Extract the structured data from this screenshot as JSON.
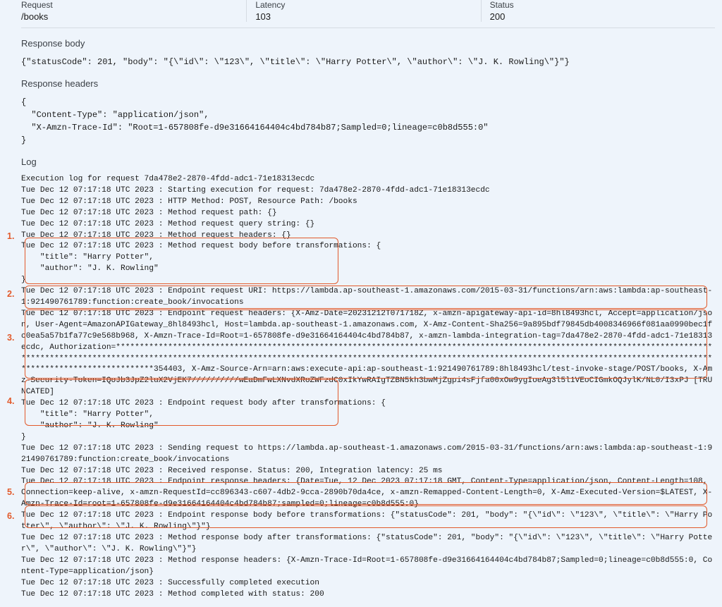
{
  "header": {
    "request_label": "Request",
    "request_value": "/books",
    "latency_label": "Latency",
    "latency_value": "103",
    "status_label": "Status",
    "status_value": "200"
  },
  "sections": {
    "response_body_title": "Response body",
    "response_body": "{\"statusCode\": 201, \"body\": \"{\\\"id\\\": \\\"123\\\", \\\"title\\\": \\\"Harry Potter\\\", \\\"author\\\": \\\"J. K. Rowling\\\"}\"}",
    "response_headers_title": "Response headers",
    "response_headers": "{\n  \"Content-Type\": \"application/json\",\n  \"X-Amzn-Trace-Id\": \"Root=1-657808fe-d9e31664164404c4bd784b87;Sampled=0;lineage=c0b8d555:0\"\n}",
    "log_title": "Log",
    "log_text": "Execution log for request 7da478e2-2870-4fdd-adc1-71e18313ecdc\nTue Dec 12 07:17:18 UTC 2023 : Starting execution for request: 7da478e2-2870-4fdd-adc1-71e18313ecdc\nTue Dec 12 07:17:18 UTC 2023 : HTTP Method: POST, Resource Path: /books\nTue Dec 12 07:17:18 UTC 2023 : Method request path: {}\nTue Dec 12 07:17:18 UTC 2023 : Method request query string: {}\nTue Dec 12 07:17:18 UTC 2023 : Method request headers: {}\nTue Dec 12 07:17:18 UTC 2023 : Method request body before transformations: {\n    \"title\": \"Harry Potter\",\n    \"author\": \"J. K. Rowling\"\n}\nTue Dec 12 07:17:18 UTC 2023 : Endpoint request URI: https://lambda.ap-southeast-1.amazonaws.com/2015-03-31/functions/arn:aws:lambda:ap-southeast-1:921490761789:function:create_book/invocations\nTue Dec 12 07:17:18 UTC 2023 : Endpoint request headers: {X-Amz-Date=20231212T071718Z, x-amzn-apigateway-api-id=8hl8493hcl, Accept=application/json, User-Agent=AmazonAPIGateway_8hl8493hcl, Host=lambda.ap-southeast-1.amazonaws.com, X-Amz-Content-Sha256=9a895bdf79845db4008346966f081aa0990bec1fc0ea5a57b1fa77c9e568b968, X-Amzn-Trace-Id=Root=1-657808fe-d9e31664164404c4bd784b87, x-amzn-lambda-integration-tag=7da478e2-2870-4fdd-adc1-71e18313ecdc, Authorization=************************************************************************************************************************************************************************************************************************************************************************************************************354403, X-Amz-Source-Arn=arn:aws:execute-api:ap-southeast-1:921490761789:8hl8493hcl/test-invoke-stage/POST/books, X-Amz-Security-Token=IQoJb3JpZ2luX2VjEK7//////////wEaDmFwLXNvdXRoZWFzdC0xIkYwRAIgTZBN5kh3bwMjZgpi4sFjfa00xOw9ygIoeAg3l5l1VEoCIGmkOQJylK/NL0/I3xPJ [TRUNCATED]\nTue Dec 12 07:17:18 UTC 2023 : Endpoint request body after transformations: {\n    \"title\": \"Harry Potter\",\n    \"author\": \"J. K. Rowling\"\n}\nTue Dec 12 07:17:18 UTC 2023 : Sending request to https://lambda.ap-southeast-1.amazonaws.com/2015-03-31/functions/arn:aws:lambda:ap-southeast-1:921490761789:function:create_book/invocations\nTue Dec 12 07:17:18 UTC 2023 : Received response. Status: 200, Integration latency: 25 ms\nTue Dec 12 07:17:18 UTC 2023 : Endpoint response headers: {Date=Tue, 12 Dec 2023 07:17:18 GMT, Content-Type=application/json, Content-Length=108, Connection=keep-alive, x-amzn-RequestId=cc896343-c607-4db2-9cca-2890b70da4ce, x-amzn-Remapped-Content-Length=0, X-Amz-Executed-Version=$LATEST, X-Amzn-Trace-Id=root=1-657808fe-d9e31664164404c4bd784b87;sampled=0;lineage=c0b8d555:0}\nTue Dec 12 07:17:18 UTC 2023 : Endpoint response body before transformations: {\"statusCode\": 201, \"body\": \"{\\\"id\\\": \\\"123\\\", \\\"title\\\": \\\"Harry Potter\\\", \\\"author\\\": \\\"J. K. Rowling\\\"}\"}\nTue Dec 12 07:17:18 UTC 2023 : Method response body after transformations: {\"statusCode\": 201, \"body\": \"{\\\"id\\\": \\\"123\\\", \\\"title\\\": \\\"Harry Potter\\\", \\\"author\\\": \\\"J. K. Rowling\\\"}\"}\nTue Dec 12 07:17:18 UTC 2023 : Method response headers: {X-Amzn-Trace-Id=Root=1-657808fe-d9e31664164404c4bd784b87;Sampled=0;lineage=c0b8d555:0, Content-Type=application/json}\nTue Dec 12 07:17:18 UTC 2023 : Successfully completed execution\nTue Dec 12 07:17:18 UTC 2023 : Method completed with status: 200"
  },
  "annotations": {
    "n1": "1.",
    "n2": "2.",
    "n3": "3.",
    "n4": "4.",
    "n5": "5.",
    "n6": "6."
  }
}
